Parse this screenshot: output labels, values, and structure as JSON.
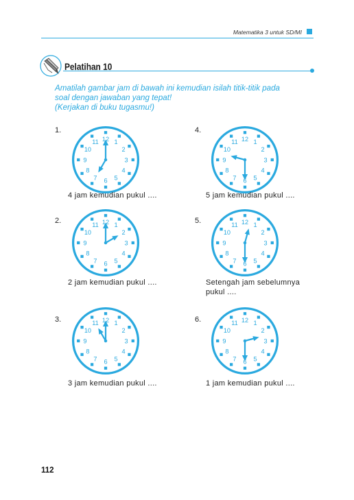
{
  "header": {
    "book_title": "Matematika 3 untuk SD/MI"
  },
  "section": {
    "title": "Pelatihan 10"
  },
  "instruction": {
    "line1": "Amatilah gambar jam di bawah ini kemudian isilah titik-titik pada",
    "line2": "soal dengan jawaban yang tepat!",
    "line3": "(Kerjakan di buku tugasmu!)"
  },
  "clock_labels": [
    "12",
    "1",
    "2",
    "3",
    "4",
    "5",
    "6",
    "7",
    "8",
    "9",
    "10",
    "11"
  ],
  "problems": [
    {
      "number": "1.",
      "caption_line1": "4 jam kemudian pukul ....",
      "caption_line2": "",
      "time": {
        "hour": 7,
        "minute": 0
      }
    },
    {
      "number": "2.",
      "caption_line1": "2 jam kemudian pukul ....",
      "caption_line2": "",
      "time": {
        "hour": 2,
        "minute": 0
      }
    },
    {
      "number": "3.",
      "caption_line1": "3 jam kemudian pukul ....",
      "caption_line2": "",
      "time": {
        "hour": 11,
        "minute": 0
      }
    },
    {
      "number": "4.",
      "caption_line1": "5 jam kemudian pukul ....",
      "caption_line2": "",
      "time": {
        "hour": 9,
        "minute": 30
      }
    },
    {
      "number": "5.",
      "caption_line1": "Setengah jam sebelumnya",
      "caption_line2": "pukul ....",
      "time": {
        "hour": 12,
        "minute": 30
      }
    },
    {
      "number": "6.",
      "caption_line1": "1 jam kemudian pukul ....",
      "caption_line2": "",
      "time": {
        "hour": 2,
        "minute": 30
      }
    }
  ],
  "page": {
    "number": "112"
  },
  "colors": {
    "accent": "#2aa9df",
    "text": "#222222"
  }
}
